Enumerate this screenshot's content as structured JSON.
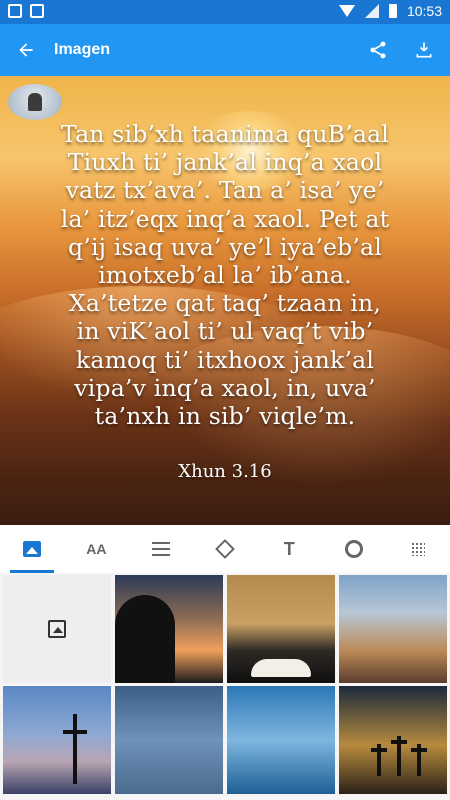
{
  "status": {
    "time": "10:53"
  },
  "appbar": {
    "title": "Imagen"
  },
  "verse": {
    "lines": [
      "Tan sib’xh taanima quB’aal",
      "Tiuxh ti’ jank’al inq’a xaol",
      "vatz tx’ava’. Tan a’ isa’ ye’",
      "la’ itz’eqx inq’a xaol. Pet at",
      "q’ij isaq uva’ ye’l iya’eb’al",
      "imotxeb’al la’ ib’ana.",
      "Xa’tetze qat taq’ tzaan in,",
      "in viK’aol ti’ ul vaq’t vib’",
      "kamoq ti’ itxhoox jank’al",
      "vipa’v inq’a xaol, in, uva’",
      "ta’nxh in sib’ viqle’m."
    ],
    "reference": "Xhun 3.16"
  },
  "toolbar": {
    "font_size_label": "AA",
    "text_label": "T"
  },
  "icons": {
    "back": "arrow-left-icon",
    "share": "share-icon",
    "download": "download-icon",
    "image": "image-icon",
    "font": "font-size-icon",
    "align": "align-lines-icon",
    "fill": "paint-bucket-icon",
    "text": "text-format-icon",
    "settings": "gear-icon",
    "grid": "dot-grid-icon",
    "add_image": "add-photo-icon"
  },
  "colors": {
    "status_bar": "#1976d2",
    "app_bar": "#2196f3",
    "accent": "#1976d2"
  }
}
